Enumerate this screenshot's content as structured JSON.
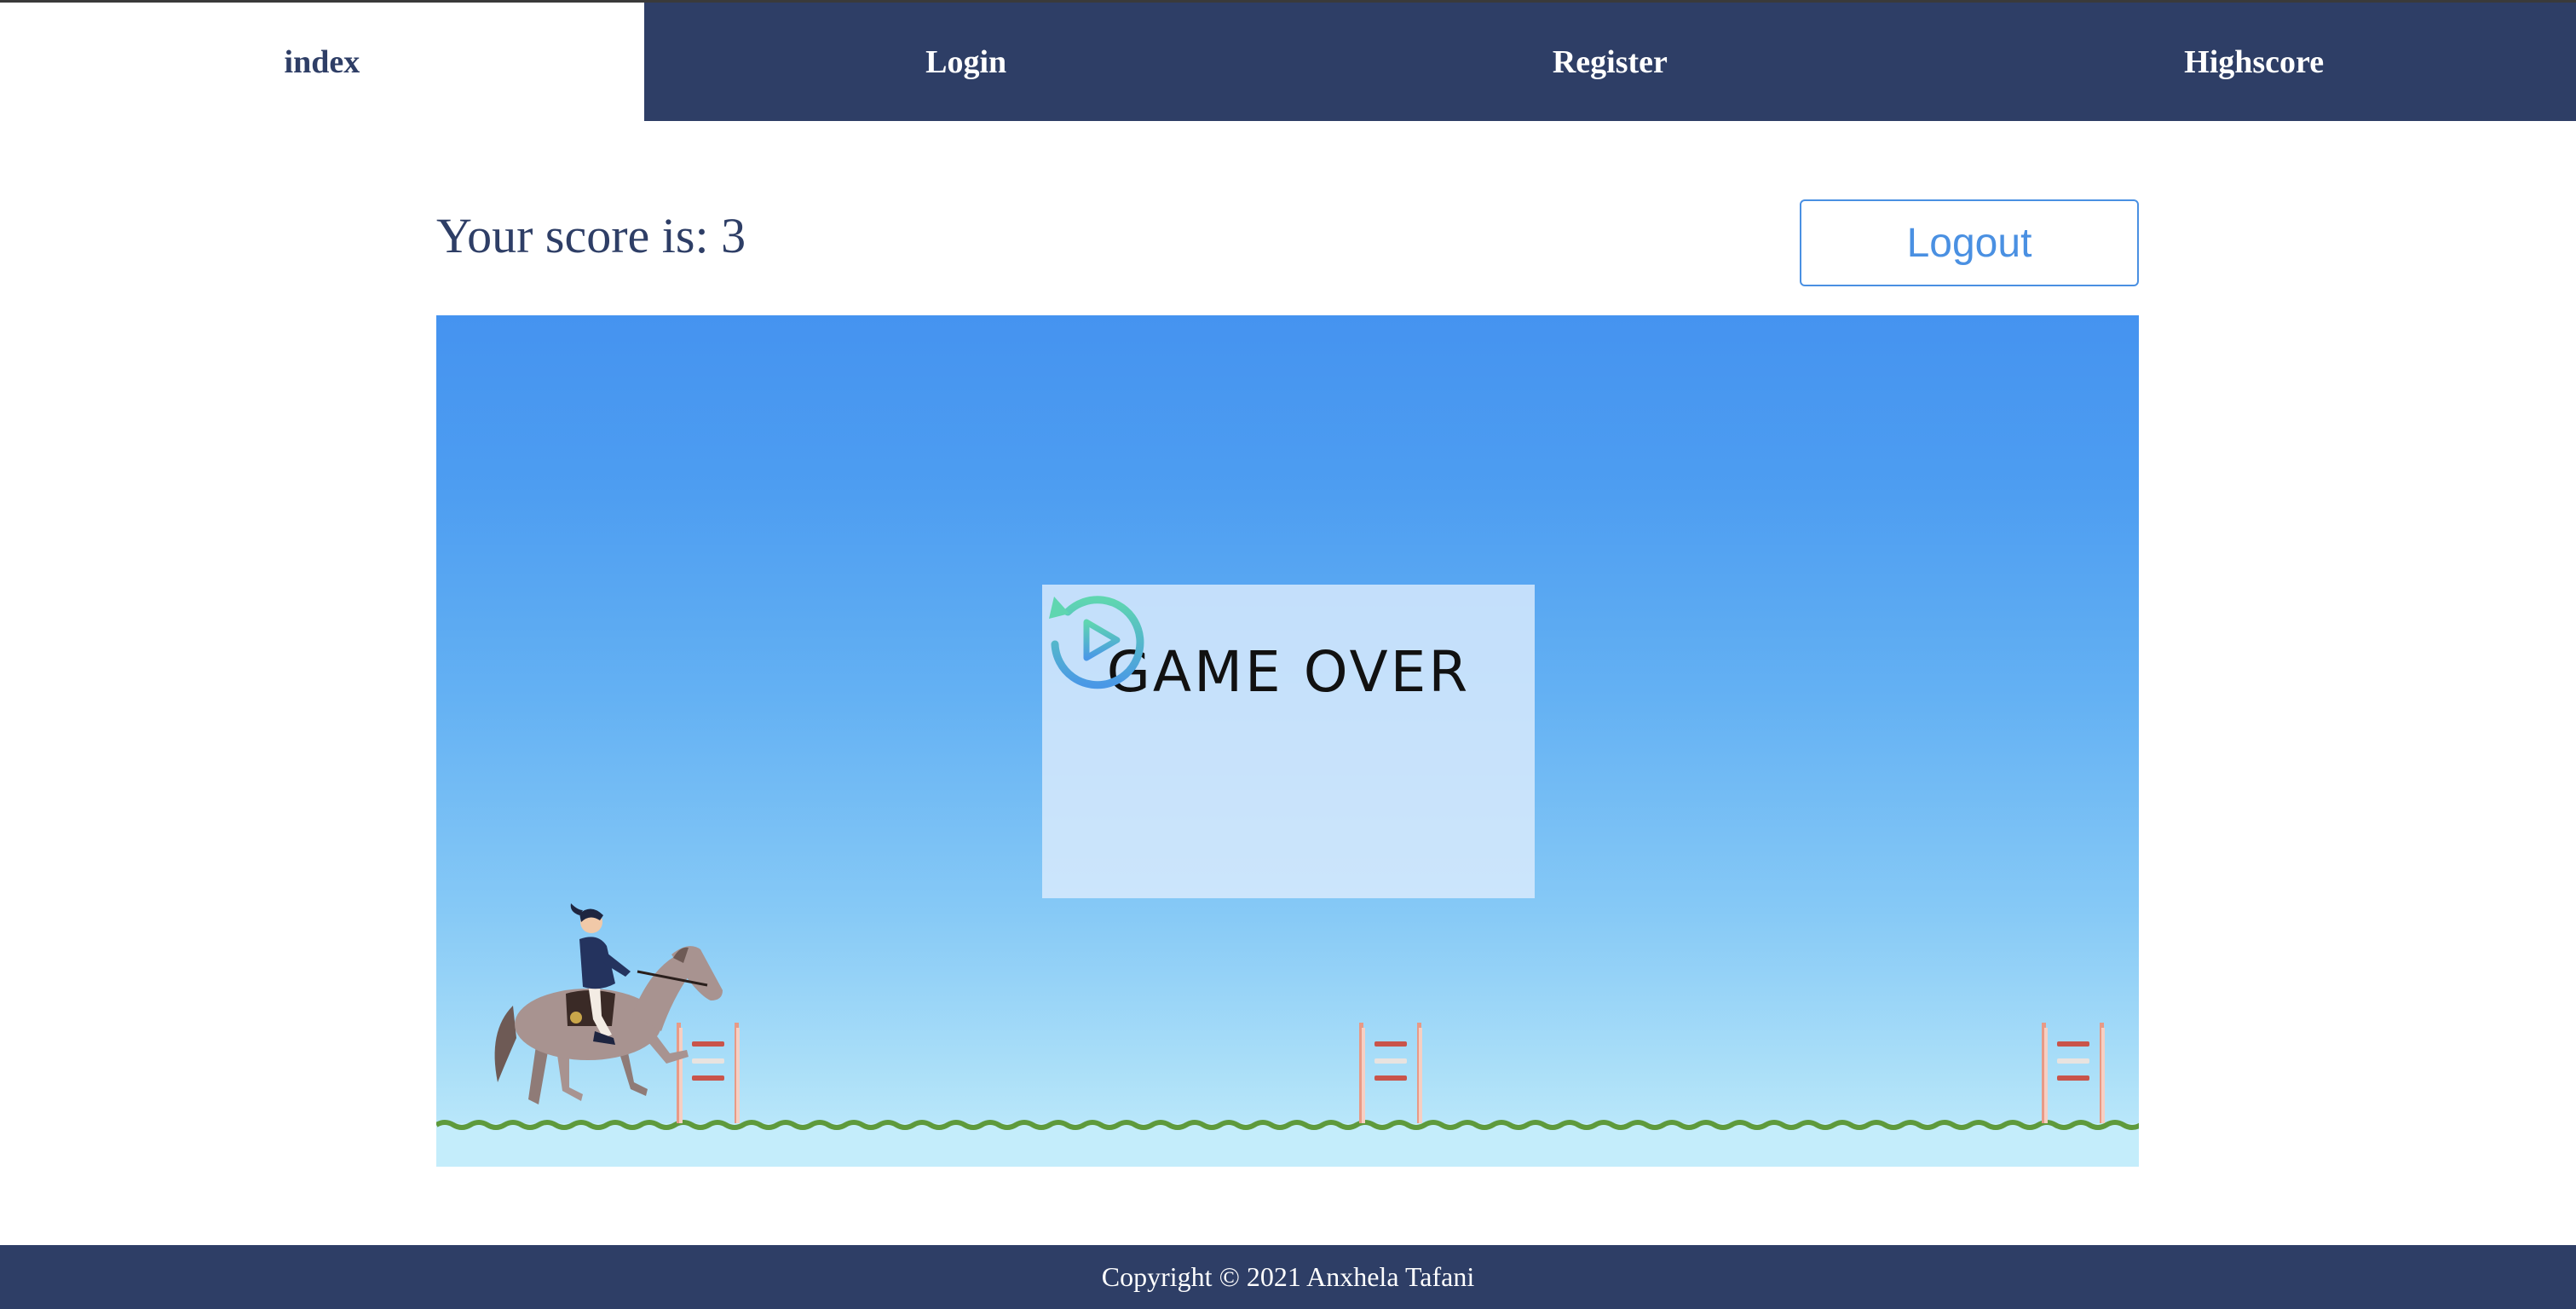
{
  "nav": {
    "tabs": [
      {
        "label": "index",
        "active": true
      },
      {
        "label": "Login",
        "active": false
      },
      {
        "label": "Register",
        "active": false
      },
      {
        "label": "Highscore",
        "active": false
      }
    ]
  },
  "score": {
    "text": "Your score is: 3",
    "value": 3
  },
  "header": {
    "logout_label": "Logout"
  },
  "game": {
    "overlay_title": "GAME OVER",
    "restart_icon": "replay-icon",
    "obstacle_count": 3,
    "player_icon": "horse-rider-icon"
  },
  "footer": {
    "copyright": "Copyright © 2021 Anxhela Tafani"
  },
  "colors": {
    "nav_bg": "#2e3e66",
    "accent": "#4a90e2",
    "sky_top": "#4593f0",
    "sky_bottom": "#c4edfb",
    "grass": "#5e9a3c",
    "hurdle_post": "#e89a86",
    "hurdle_bar": "#c9544a"
  }
}
